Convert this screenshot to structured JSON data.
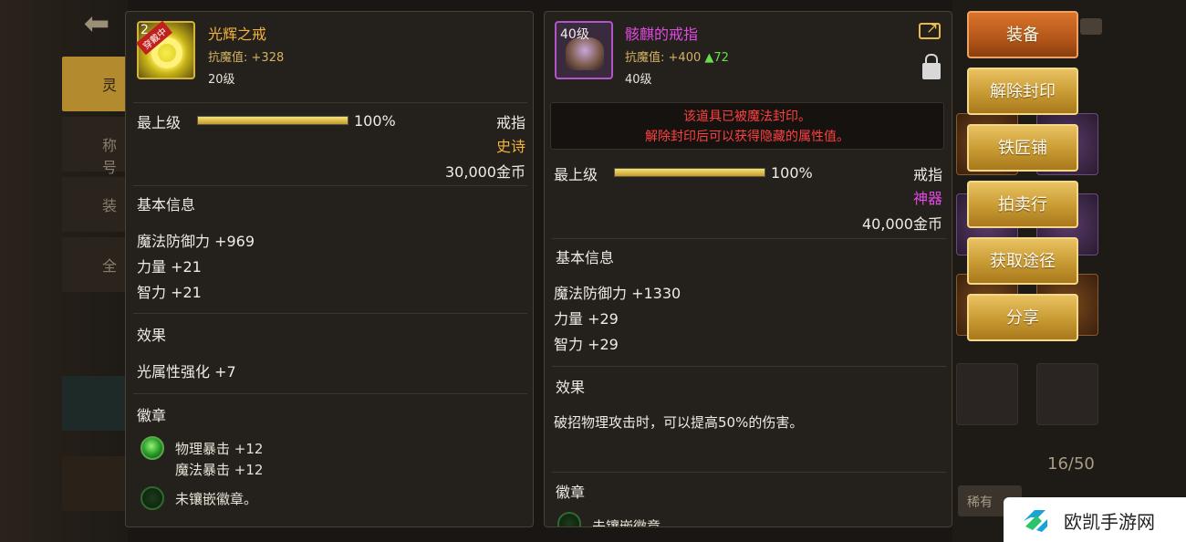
{
  "background": {
    "tabs": [
      "灵",
      "称号",
      "装",
      "全"
    ],
    "inventory_count": "16/50",
    "sort_label": "稀有"
  },
  "left_item": {
    "icon_number": "2",
    "equipped_badge": "穿戴中",
    "name": "光辉之戒",
    "resist_label": "抗魔值:",
    "resist_value": "+328",
    "level": "20级",
    "grade": "最上级",
    "grade_percent": 100,
    "grade_percent_text": "100%",
    "type": "戒指",
    "rarity": "史诗",
    "price": "30,000金币",
    "basic_info_title": "基本信息",
    "stats": [
      "魔法防御力 +969",
      "力量 +21",
      "智力 +21"
    ],
    "effect_title": "效果",
    "effect": "光属性强化 +7",
    "emblem_title": "徽章",
    "emblems": {
      "slot1_line1": "物理暴击 +12",
      "slot1_line2": "魔法暴击 +12",
      "slot2": "未镶嵌徽章。"
    }
  },
  "right_item": {
    "icon_level": "40级",
    "name": "骸麒的戒指",
    "resist_label": "抗魔值:",
    "resist_value": "+400",
    "resist_diff": "▲72",
    "level": "40级",
    "sealed_line1": "该道具已被魔法封印。",
    "sealed_line2": "解除封印后可以获得隐藏的属性值。",
    "grade": "最上级",
    "grade_percent": 100,
    "grade_percent_text": "100%",
    "type": "戒指",
    "rarity": "神器",
    "price": "40,000金币",
    "basic_info_title": "基本信息",
    "stats": [
      "魔法防御力 +1330",
      "力量 +29",
      "智力 +29"
    ],
    "effect_title": "效果",
    "effect": "破招物理攻击时，可以提高50%的伤害。",
    "emblem_title": "徽章",
    "emblem_partial": "未镶嵌徽章。"
  },
  "actions": {
    "equip": "装备",
    "unseal": "解除封印",
    "blacksmith": "铁匠铺",
    "auction": "拍卖行",
    "obtain": "获取途径",
    "share": "分享"
  },
  "watermark": {
    "text": "欧凯手游网"
  },
  "colors": {
    "epic": "#f2b33c",
    "artifact": "#e04ae0",
    "sealed_warning": "#ff4040",
    "button_gold": "#c89a32",
    "button_primary": "#b4561a"
  }
}
